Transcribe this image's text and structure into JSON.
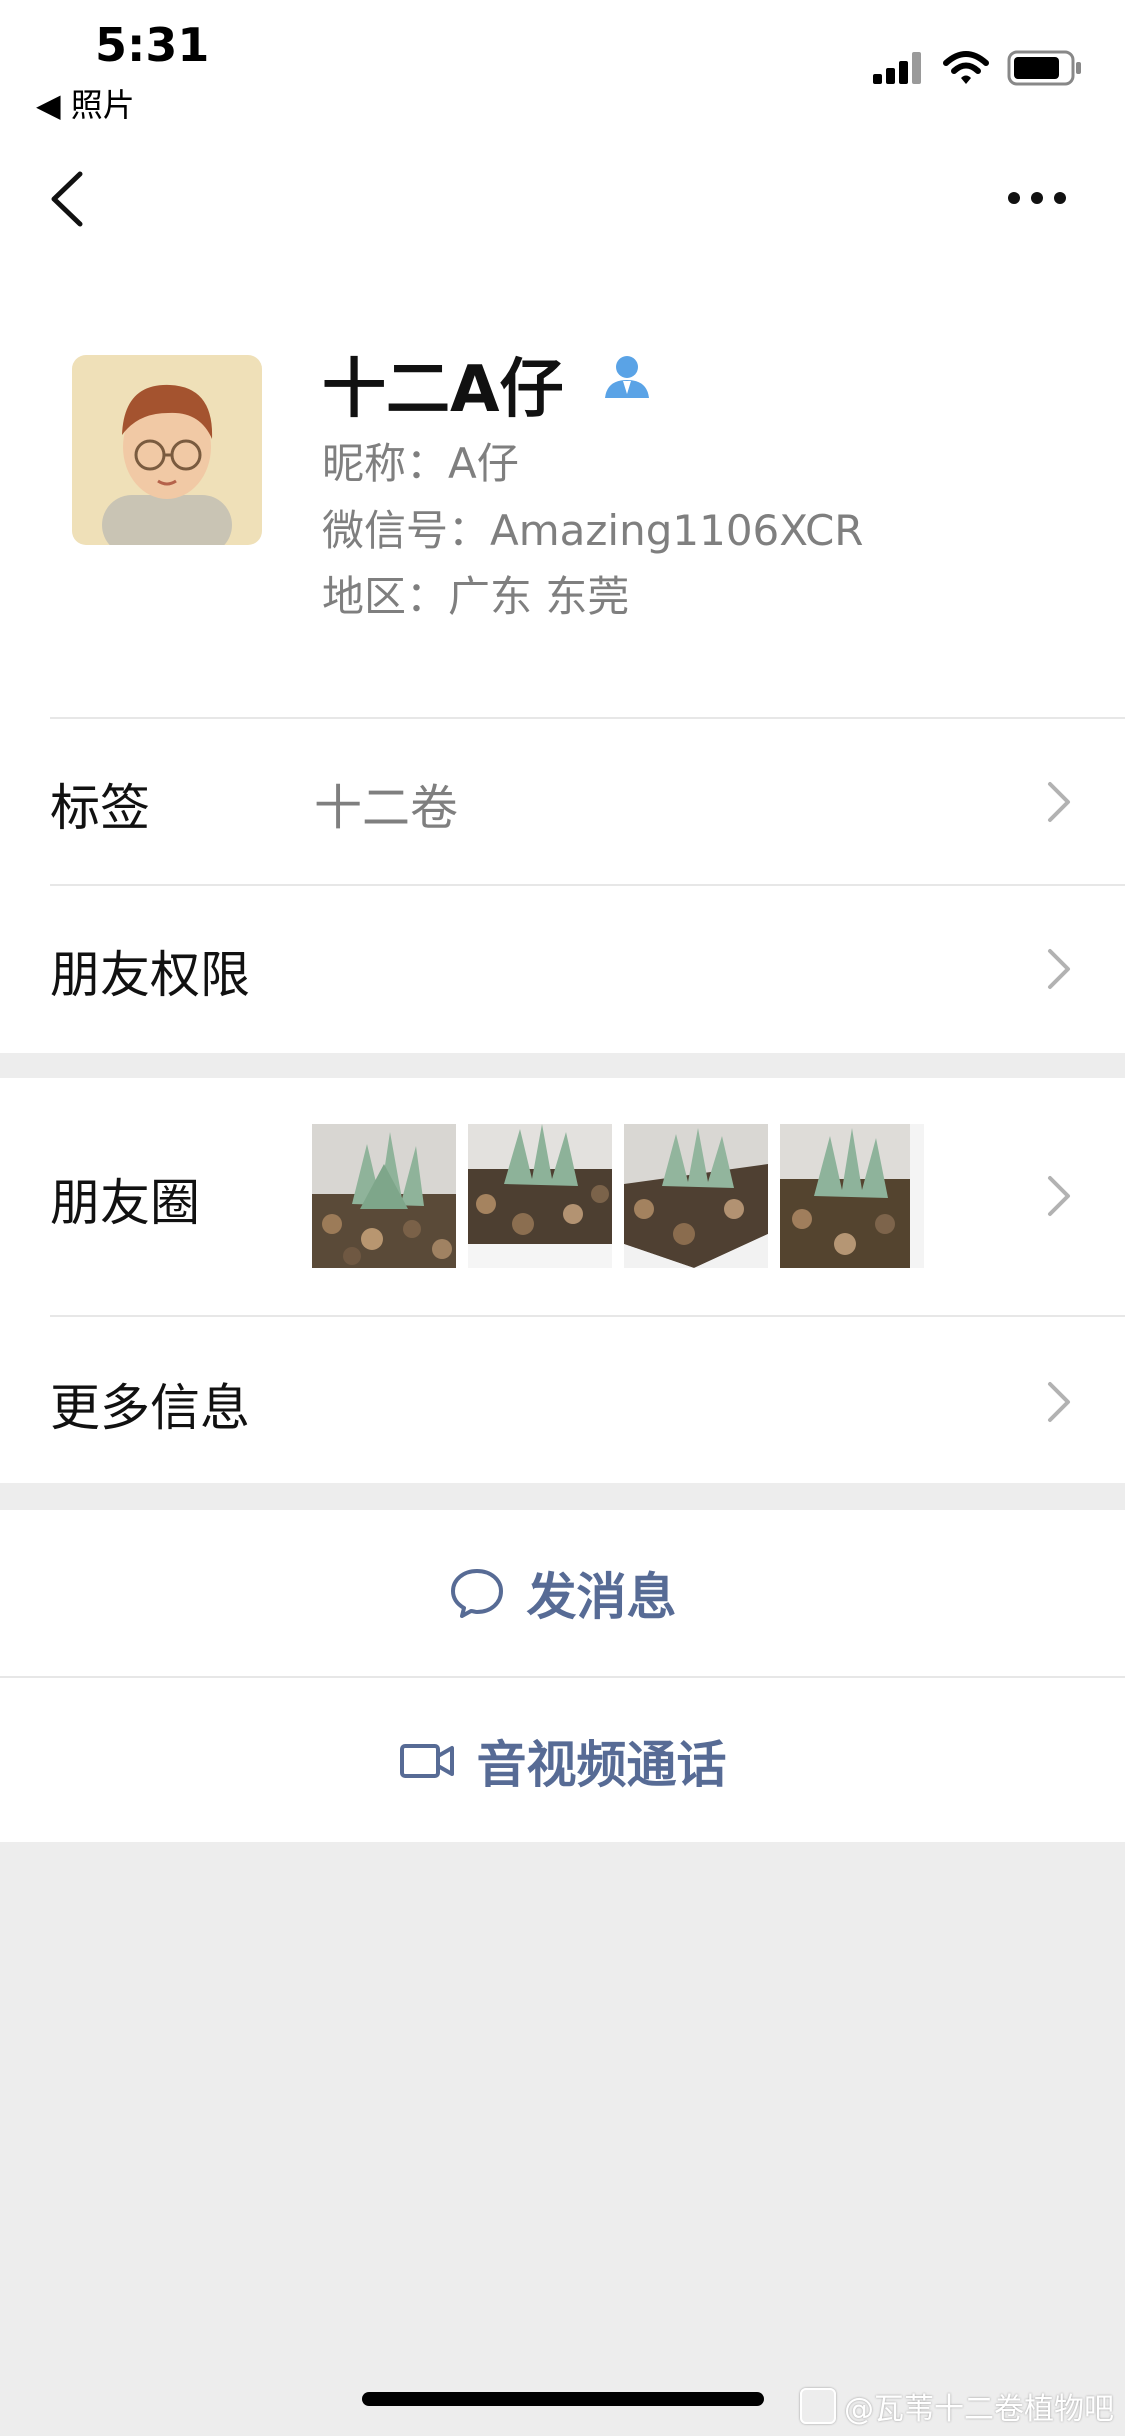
{
  "status_bar": {
    "time": "5:31",
    "back_label": "◀ 照片",
    "icons": [
      "cellular-signal-icon",
      "wifi-icon",
      "battery-icon"
    ]
  },
  "nav": {
    "back_icon": "chevron-left-icon",
    "more_icon": "more-dots-icon"
  },
  "profile": {
    "display_name": "十二A仔",
    "nickname": "昵称：A仔",
    "wechat_id": "微信号：Amazing1106XCR",
    "region": "地区：广东 东莞",
    "verified_icon": "person-badge-icon",
    "accent_color": "#5aa3e6"
  },
  "rows": {
    "tags": {
      "label": "标签",
      "value": "十二卷"
    },
    "friend_permissions": {
      "label": "朋友权限"
    },
    "moments": {
      "label": "朋友圈"
    },
    "more_info": {
      "label": "更多信息"
    }
  },
  "actions": {
    "send_message": {
      "label": "发消息",
      "icon": "chat-bubble-icon"
    },
    "video_call": {
      "label": "音视频通话",
      "icon": "video-camera-icon"
    },
    "color": "#576b95"
  },
  "watermark": "@瓦苇十二卷植物吧"
}
